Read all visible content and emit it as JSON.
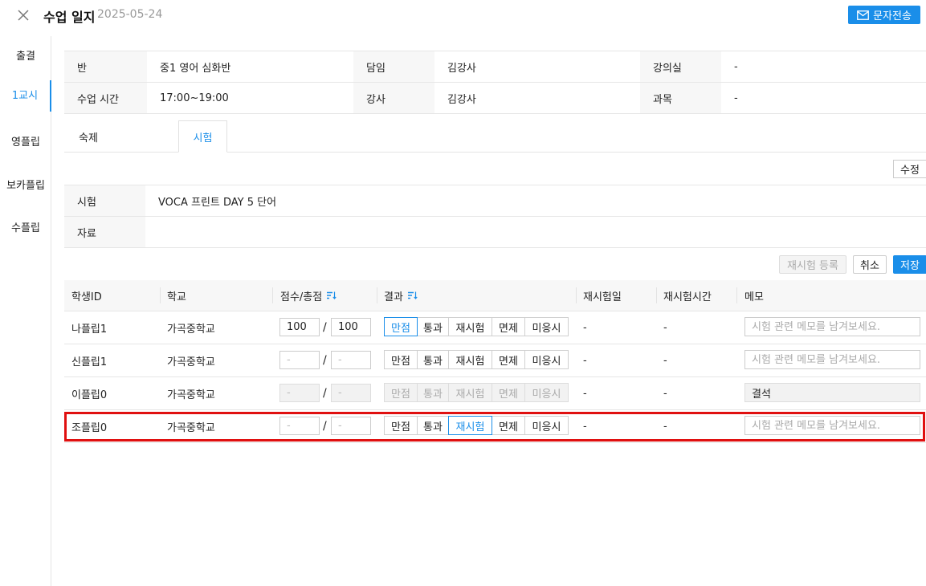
{
  "header": {
    "title": "수업 일지",
    "date": "2025-05-24",
    "sms_label": "문자전송"
  },
  "sidebar": {
    "items": [
      {
        "label": "출결"
      },
      {
        "label": "1교시",
        "active": true
      },
      {
        "label": "영플립"
      },
      {
        "label": "보카플립"
      },
      {
        "label": "수플립"
      }
    ]
  },
  "class_info": {
    "row1": {
      "l1": "반",
      "v1": "중1 영어 심화반",
      "l2": "담임",
      "v2": "김강사",
      "l3": "강의실",
      "v3": "-"
    },
    "row2": {
      "l1": "수업 시간",
      "v1": "17:00~19:00",
      "l2": "강사",
      "v2": "김강사",
      "l3": "과목",
      "v3": "-"
    }
  },
  "tabs": [
    {
      "label": "숙제"
    },
    {
      "label": "시험",
      "active": true
    }
  ],
  "edit_label": "수정",
  "exam_info": {
    "exam_label": "시험",
    "exam_value": "VOCA 프린트 DAY 5 단어",
    "material_label": "자료",
    "material_value": ""
  },
  "actions": {
    "retake_label": "재시험 등록",
    "cancel_label": "취소",
    "save_label": "저장"
  },
  "table": {
    "headers": {
      "student_id": "학생ID",
      "school": "학교",
      "score": "점수/총점",
      "result": "결과",
      "retake_date": "재시험일",
      "retake_time": "재시험시간",
      "memo": "메모"
    },
    "result_options": [
      "만점",
      "통과",
      "재시험",
      "면제",
      "미응시"
    ],
    "slash": "/",
    "memo_placeholder": "시험 관련 메모를 남겨보세요.",
    "rows": [
      {
        "student_id": "나플립1",
        "school": "가곡중학교",
        "score": "100",
        "total": "100",
        "score_placeholder": "-",
        "result_selected": "만점",
        "disabled": false,
        "retake_date": "-",
        "retake_time": "-",
        "memo": ""
      },
      {
        "student_id": "신플립1",
        "school": "가곡중학교",
        "score": "",
        "total": "",
        "score_placeholder": "-",
        "result_selected": "",
        "disabled": false,
        "retake_date": "-",
        "retake_time": "-",
        "memo": ""
      },
      {
        "student_id": "이플립0",
        "school": "가곡중학교",
        "score": "",
        "total": "",
        "score_placeholder": "-",
        "result_selected": "",
        "disabled": true,
        "retake_date": "-",
        "retake_time": "-",
        "memo": "결석"
      },
      {
        "student_id": "조플립0",
        "school": "가곡중학교",
        "score": "",
        "total": "",
        "score_placeholder": "-",
        "result_selected": "재시험",
        "disabled": false,
        "retake_date": "-",
        "retake_time": "-",
        "memo": ""
      }
    ]
  },
  "colors": {
    "accent": "#1a8ee9",
    "highlight": "#e01010"
  }
}
